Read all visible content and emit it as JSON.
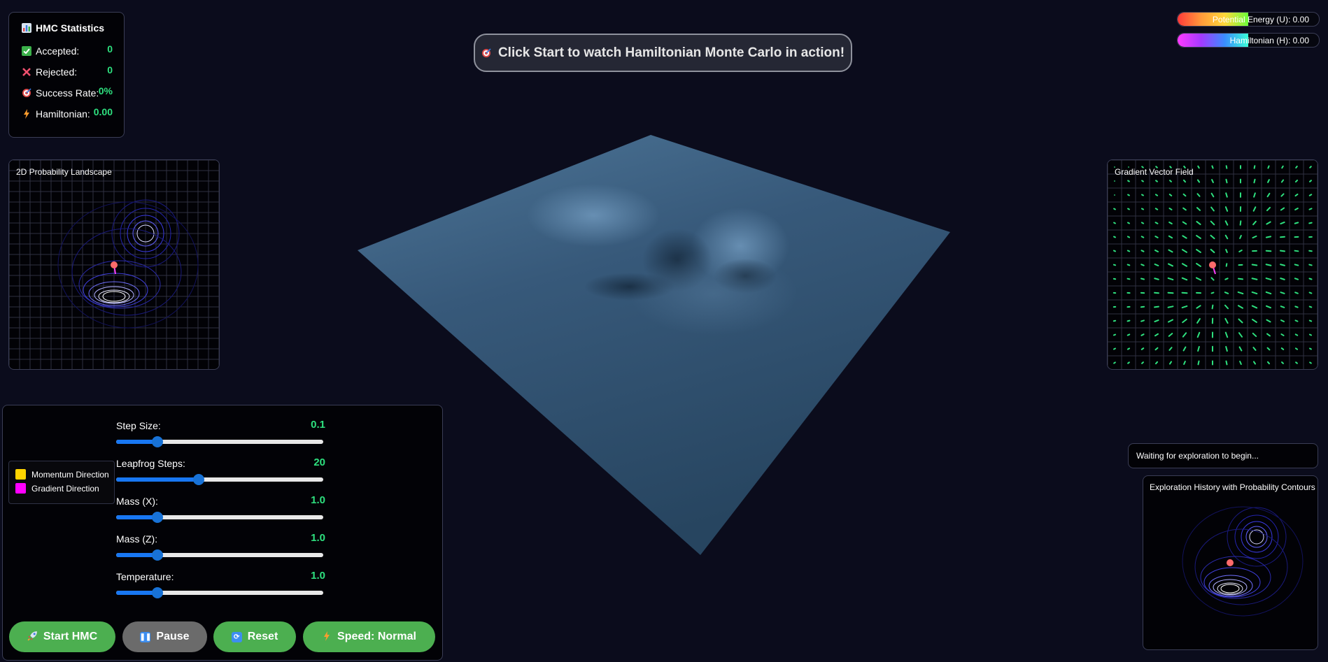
{
  "stats": {
    "title": "HMC Statistics",
    "rows": [
      {
        "icon": "check-icon",
        "label": "Accepted:",
        "value": "0"
      },
      {
        "icon": "cross-icon",
        "label": "Rejected:",
        "value": "0"
      },
      {
        "icon": "target-icon",
        "label": "Success Rate:",
        "value": "0%"
      },
      {
        "icon": "lightning-icon",
        "label": "Hamiltonian:",
        "value": "0.00"
      }
    ]
  },
  "banner": {
    "text": "Click Start to watch Hamiltonian Monte Carlo in action!",
    "icon": "target-icon"
  },
  "energy": {
    "potential_label": "Potential Energy (U): 0.00",
    "hamiltonian_label": "Hamiltonian (H): 0.00"
  },
  "landscape": {
    "title": "2D Probability Landscape"
  },
  "gradient": {
    "title": "Gradient Vector Field"
  },
  "status": {
    "text": "Waiting for exploration to begin..."
  },
  "history": {
    "title": "Exploration History with Probability Contours"
  },
  "legend": {
    "items": [
      {
        "label": "Momentum Direction",
        "color": "#ffd400"
      },
      {
        "label": "Gradient Direction",
        "color": "#ff00ff"
      }
    ]
  },
  "sliders": [
    {
      "label": "Step Size:",
      "value": "0.1",
      "fraction": 0.2
    },
    {
      "label": "Leapfrog Steps:",
      "value": "20",
      "fraction": 0.4
    },
    {
      "label": "Mass (X):",
      "value": "1.0",
      "fraction": 0.2
    },
    {
      "label": "Mass (Z):",
      "value": "1.0",
      "fraction": 0.2
    },
    {
      "label": "Temperature:",
      "value": "1.0",
      "fraction": 0.2
    }
  ],
  "buttons": {
    "start": "Start HMC",
    "pause": "Pause",
    "reset": "Reset",
    "speed": "Speed: Normal"
  },
  "colors": {
    "accent_green": "#2ee07f",
    "button_green": "#4caf50",
    "slider_blue": "#1872d6",
    "surface": "#3a5f80"
  }
}
